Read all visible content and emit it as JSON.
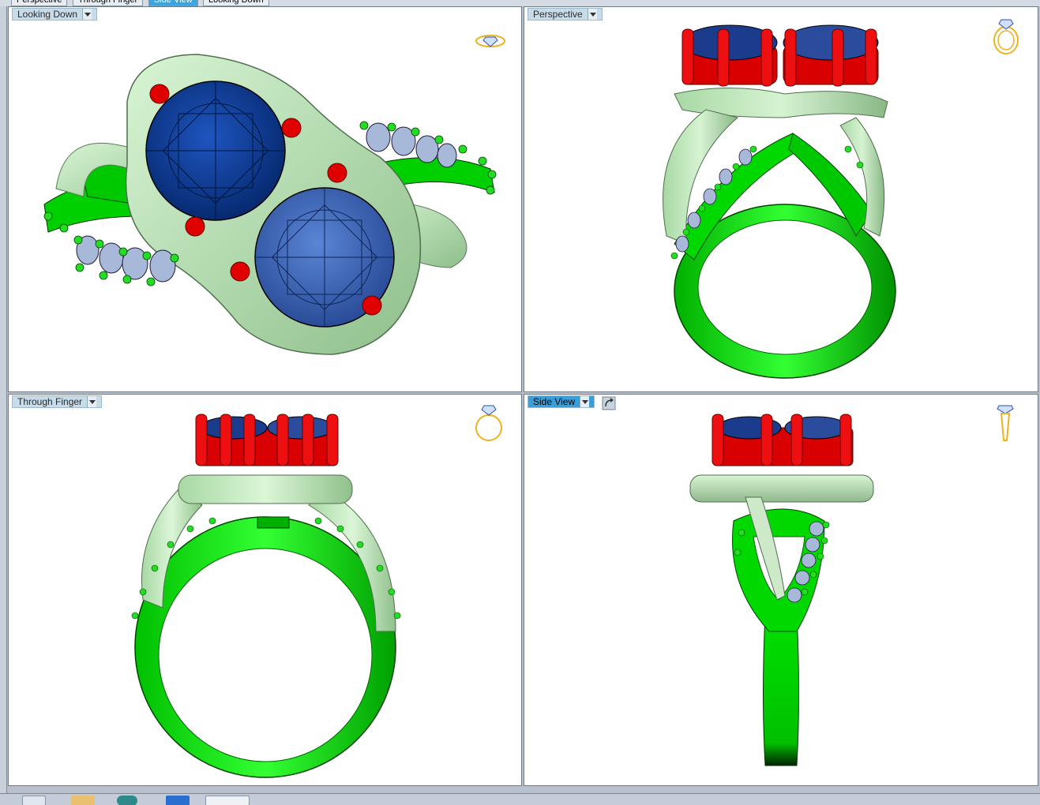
{
  "top_tabs": [
    {
      "label": "Perspective"
    },
    {
      "label": "Through Finger"
    },
    {
      "label": "Side View"
    },
    {
      "label": "Looking Down"
    }
  ],
  "viewports": {
    "top_left": {
      "label": "Looking Down",
      "icon": "ring-top-view-icon"
    },
    "top_right": {
      "label": "Perspective",
      "icon": "ring-perspective-icon"
    },
    "bottom_left": {
      "label": "Through Finger",
      "icon": "ring-front-icon"
    },
    "bottom_right": {
      "label": "Side View",
      "icon": "ring-side-icon",
      "active": true
    }
  },
  "colors": {
    "shank_green": "#00e000",
    "mint_band": "#bfeabb",
    "prong_red": "#e00000",
    "stone_dark_blue": "#0b3b9a",
    "stone_light_blue": "#3a64b8",
    "icon_gold": "#f0b020",
    "active_tab": "#3aa6e0"
  }
}
